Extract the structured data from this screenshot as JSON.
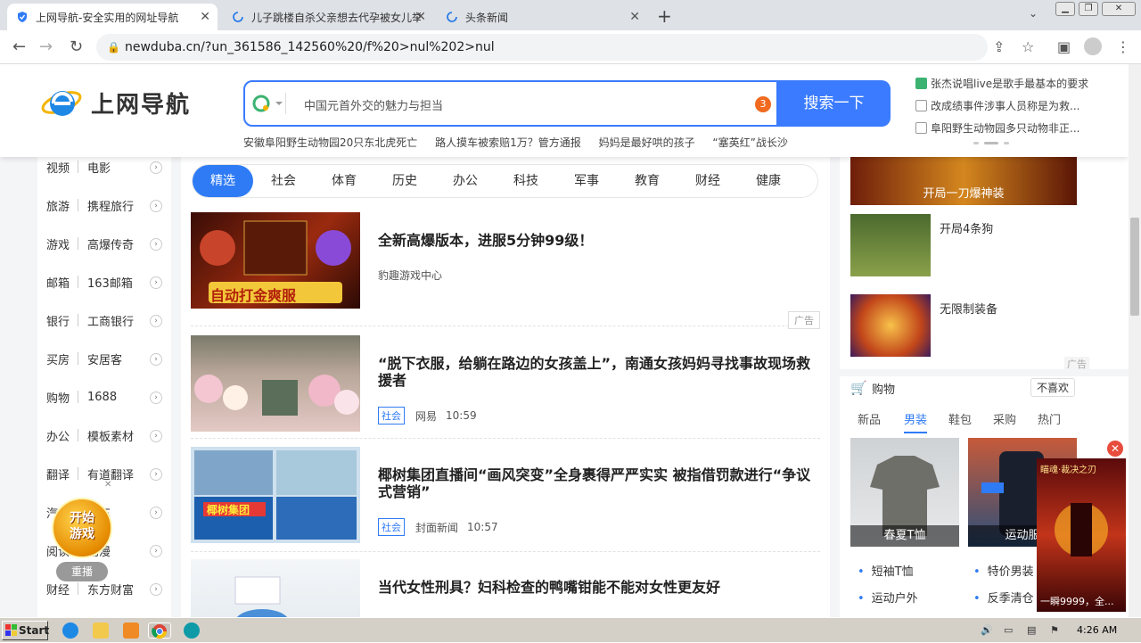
{
  "browser": {
    "tabs": [
      {
        "title": "上网导航-安全实用的网址导航",
        "active": true
      },
      {
        "title": "儿子跳楼自杀父亲想去代孕被女儿举报",
        "active": false
      },
      {
        "title": "头条新闻",
        "active": false
      }
    ],
    "url": "newduba.cn/?un_361586_142560%20/f%20>nul%202>nul"
  },
  "header": {
    "logo_text": "上网导航",
    "search_query": "中国元首外交的魅力与担当",
    "search_badge": "3",
    "search_button": "搜索一下",
    "hot_links": [
      "安徽阜阳野生动物园20只东北虎死亡",
      "路人摸车被索赔1万？管方通报",
      "妈妈是最好哄的孩子",
      "“塞英红”战长沙"
    ],
    "right_news": [
      {
        "text": "张杰说唱live是歌手最基本的要求",
        "icon": "new-icon"
      },
      {
        "text": "改成绩事件涉事人员称是为救...",
        "icon": "search-icon"
      },
      {
        "text": "阜阳野生动物园多只动物非正...",
        "icon": "search-icon"
      }
    ]
  },
  "sidebar": {
    "items": [
      {
        "cat": "视频",
        "site": "电影"
      },
      {
        "cat": "旅游",
        "site": "携程旅行"
      },
      {
        "cat": "游戏",
        "site": "高爆传奇"
      },
      {
        "cat": "邮箱",
        "site": "163邮箱"
      },
      {
        "cat": "银行",
        "site": "工商银行"
      },
      {
        "cat": "买房",
        "site": "安居客"
      },
      {
        "cat": "购物",
        "site": "1688"
      },
      {
        "cat": "办公",
        "site": "模板素材"
      },
      {
        "cat": "翻译",
        "site": "有道翻译"
      },
      {
        "cat": "汽车",
        "site": "汽车"
      },
      {
        "cat": "阅读",
        "site": "动漫"
      },
      {
        "cat": "财经",
        "site": "东方财富"
      }
    ],
    "game_float": {
      "line1": "开始",
      "line2": "游戏",
      "replay": "重播"
    }
  },
  "content_tabs": [
    "精选",
    "社会",
    "体育",
    "历史",
    "办公",
    "科技",
    "军事",
    "教育",
    "财经",
    "健康"
  ],
  "feed": [
    {
      "title": "全新高爆版本，进服5分钟99级！",
      "source": "豹趣游戏中心",
      "ad_label": "广告",
      "thumb_text": "自动打金爽服"
    },
    {
      "title": "“脱下衣服，给躺在路边的女孩盖上”，南通女孩妈妈寻找事故现场救援者",
      "tag": "社会",
      "source": "网易",
      "time": "10:59"
    },
    {
      "title": "椰树集团直播间“画风突变”全身裹得严严实实 被指借罚款进行“争议式营销”",
      "tag": "社会",
      "source": "封面新闻",
      "time": "10:57",
      "thumb_text": "椰树集团"
    },
    {
      "title": "当代女性刑具？妇科检查的鸭嘴钳能不能对女性更友好"
    }
  ],
  "right_col": {
    "top_banner": "开局一刀爆神装",
    "items": [
      "开局4条狗",
      "无限制装备"
    ],
    "ad_label": "广告",
    "shop": {
      "title": "购物",
      "dislike": "不喜欢",
      "tabs": [
        "新品",
        "男装",
        "鞋包",
        "采购",
        "热门"
      ],
      "products": [
        "春夏T恤",
        "运动服"
      ],
      "links": [
        "短袖T恤",
        "特价男装",
        "运动户外",
        "反季清仓"
      ]
    },
    "float_ad": {
      "title": "瞄魂·裁决之刃",
      "bottom": "一瞬9999，全..."
    }
  },
  "taskbar": {
    "start": "Start",
    "clock": "4:26 AM"
  }
}
